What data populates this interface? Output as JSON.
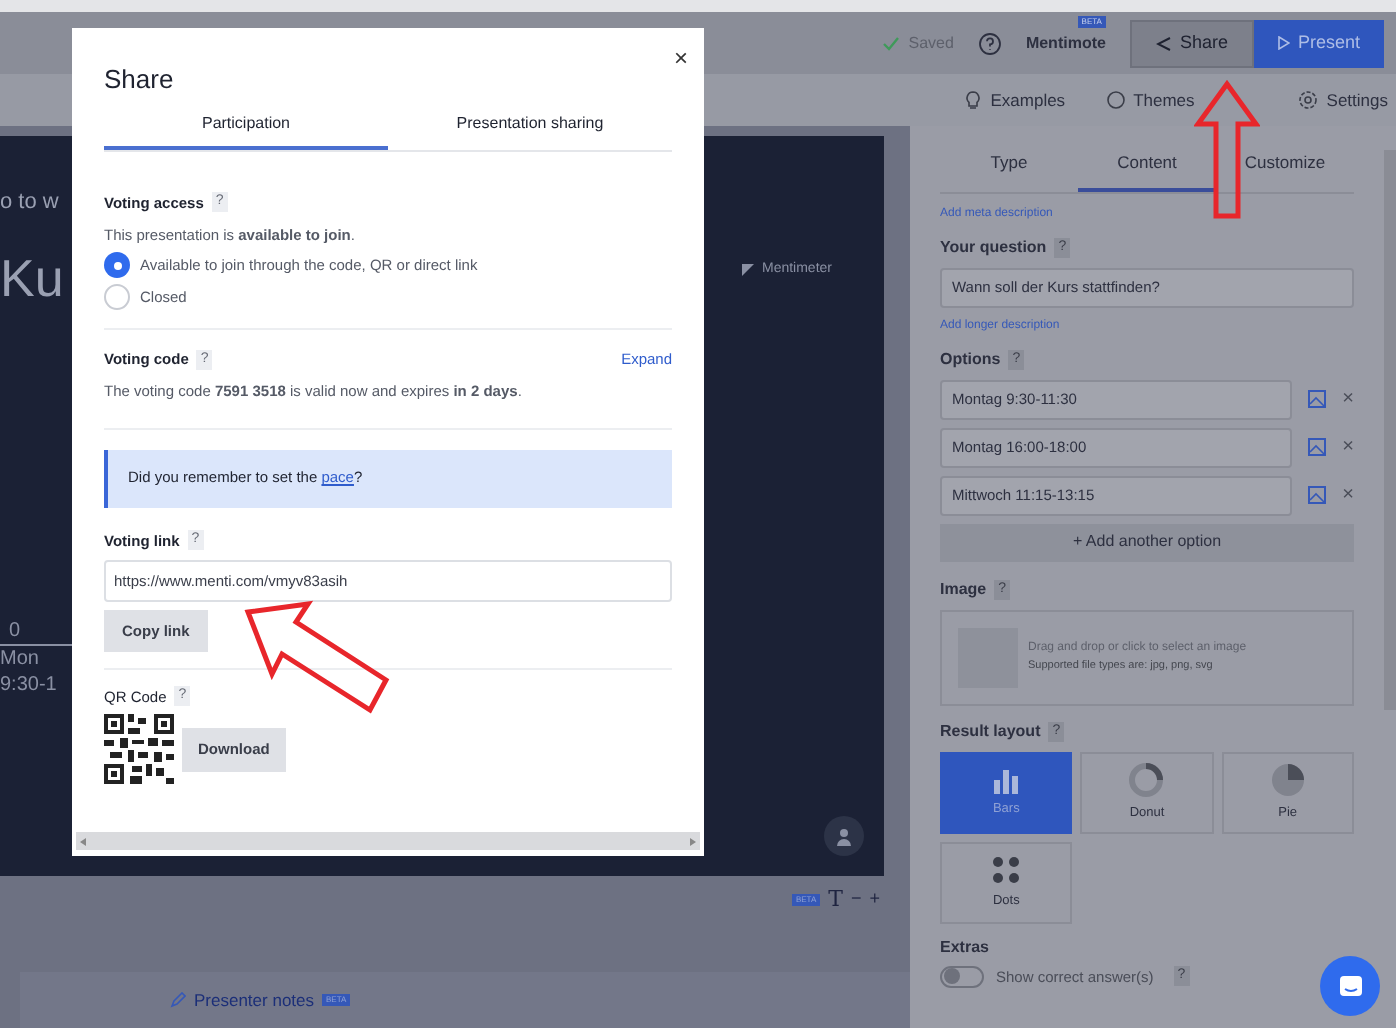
{
  "header": {
    "saved": "Saved",
    "app": "Mentimote",
    "app_badge": "BETA",
    "share": "Share",
    "present": "Present"
  },
  "toolbar": [
    "Examples",
    "Themes",
    "Settings"
  ],
  "slide": {
    "fragments": [
      "o to w",
      "Ku"
    ],
    "logo": "Mentimeter",
    "axis": [
      "0",
      "Mon",
      "9:30-1"
    ]
  },
  "slide_tools": {
    "badge": "BETA",
    "text_tool": "T",
    "minus": "−",
    "plus": "+"
  },
  "presenter_notes": {
    "label": "Presenter notes",
    "badge": "BETA"
  },
  "panel": {
    "tabs": [
      {
        "label": "Type",
        "selected": false
      },
      {
        "label": "Content",
        "selected": true
      },
      {
        "label": "Customize",
        "selected": false
      }
    ],
    "meta_link": "Add meta description",
    "question_label": "Your question",
    "question_help": "?",
    "question": "Wann soll der Kurs stattfinden?",
    "longer_link": "Add longer description",
    "options_label": "Options",
    "options_help": "?",
    "options": [
      {
        "value": "Montag 9:30-11:30",
        "remove": "×"
      },
      {
        "value": "Montag 16:00-18:00",
        "remove": "×"
      },
      {
        "value": "Mittwoch 11:15-13:15",
        "remove": "×"
      }
    ],
    "add_option": "+ Add another option",
    "image_label": "Image",
    "image_help": "?",
    "image_drop": "Drag and drop or click to select an image",
    "image_types": "Supported file types are: jpg, png, svg",
    "layout_label": "Result layout",
    "layout_help": "?",
    "layouts": [
      {
        "kind": "bars",
        "label": "Bars",
        "selected": true
      },
      {
        "kind": "donut",
        "label": "Donut",
        "selected": false
      },
      {
        "kind": "pie",
        "label": "Pie",
        "selected": false
      },
      {
        "kind": "dots",
        "label": "Dots",
        "selected": false
      }
    ],
    "extras_label": "Extras",
    "extra_on": false,
    "extra_option": "Show correct answer(s)",
    "extra_help": "?"
  },
  "modal": {
    "title": "Share",
    "close": "×",
    "tabs": [
      {
        "label": "Participation",
        "selected": true
      },
      {
        "label": "Presentation sharing",
        "selected": false
      }
    ],
    "access_label": "Voting access",
    "access_help": "?",
    "access_text": "This presentation is **available to join**.",
    "access_options": [
      {
        "label": "Available to join through the code, QR or direct link",
        "selected": true
      },
      {
        "label": "Closed",
        "selected": false
      }
    ],
    "code_label": "Voting code",
    "code_help": "?",
    "expand": "Expand",
    "code_text": "The voting code **7591 3518** is valid now and expires **in 2 days**.",
    "notice_before": "Did you remember to set the ",
    "notice_link": "pace",
    "notice_after": "?",
    "link_label": "Voting link",
    "link_help": "?",
    "link_value": "https://www.menti.com/vmyv83asih",
    "copy": "Copy link",
    "qr_label": "QR Code",
    "qr_help": "?",
    "download": "Download"
  }
}
